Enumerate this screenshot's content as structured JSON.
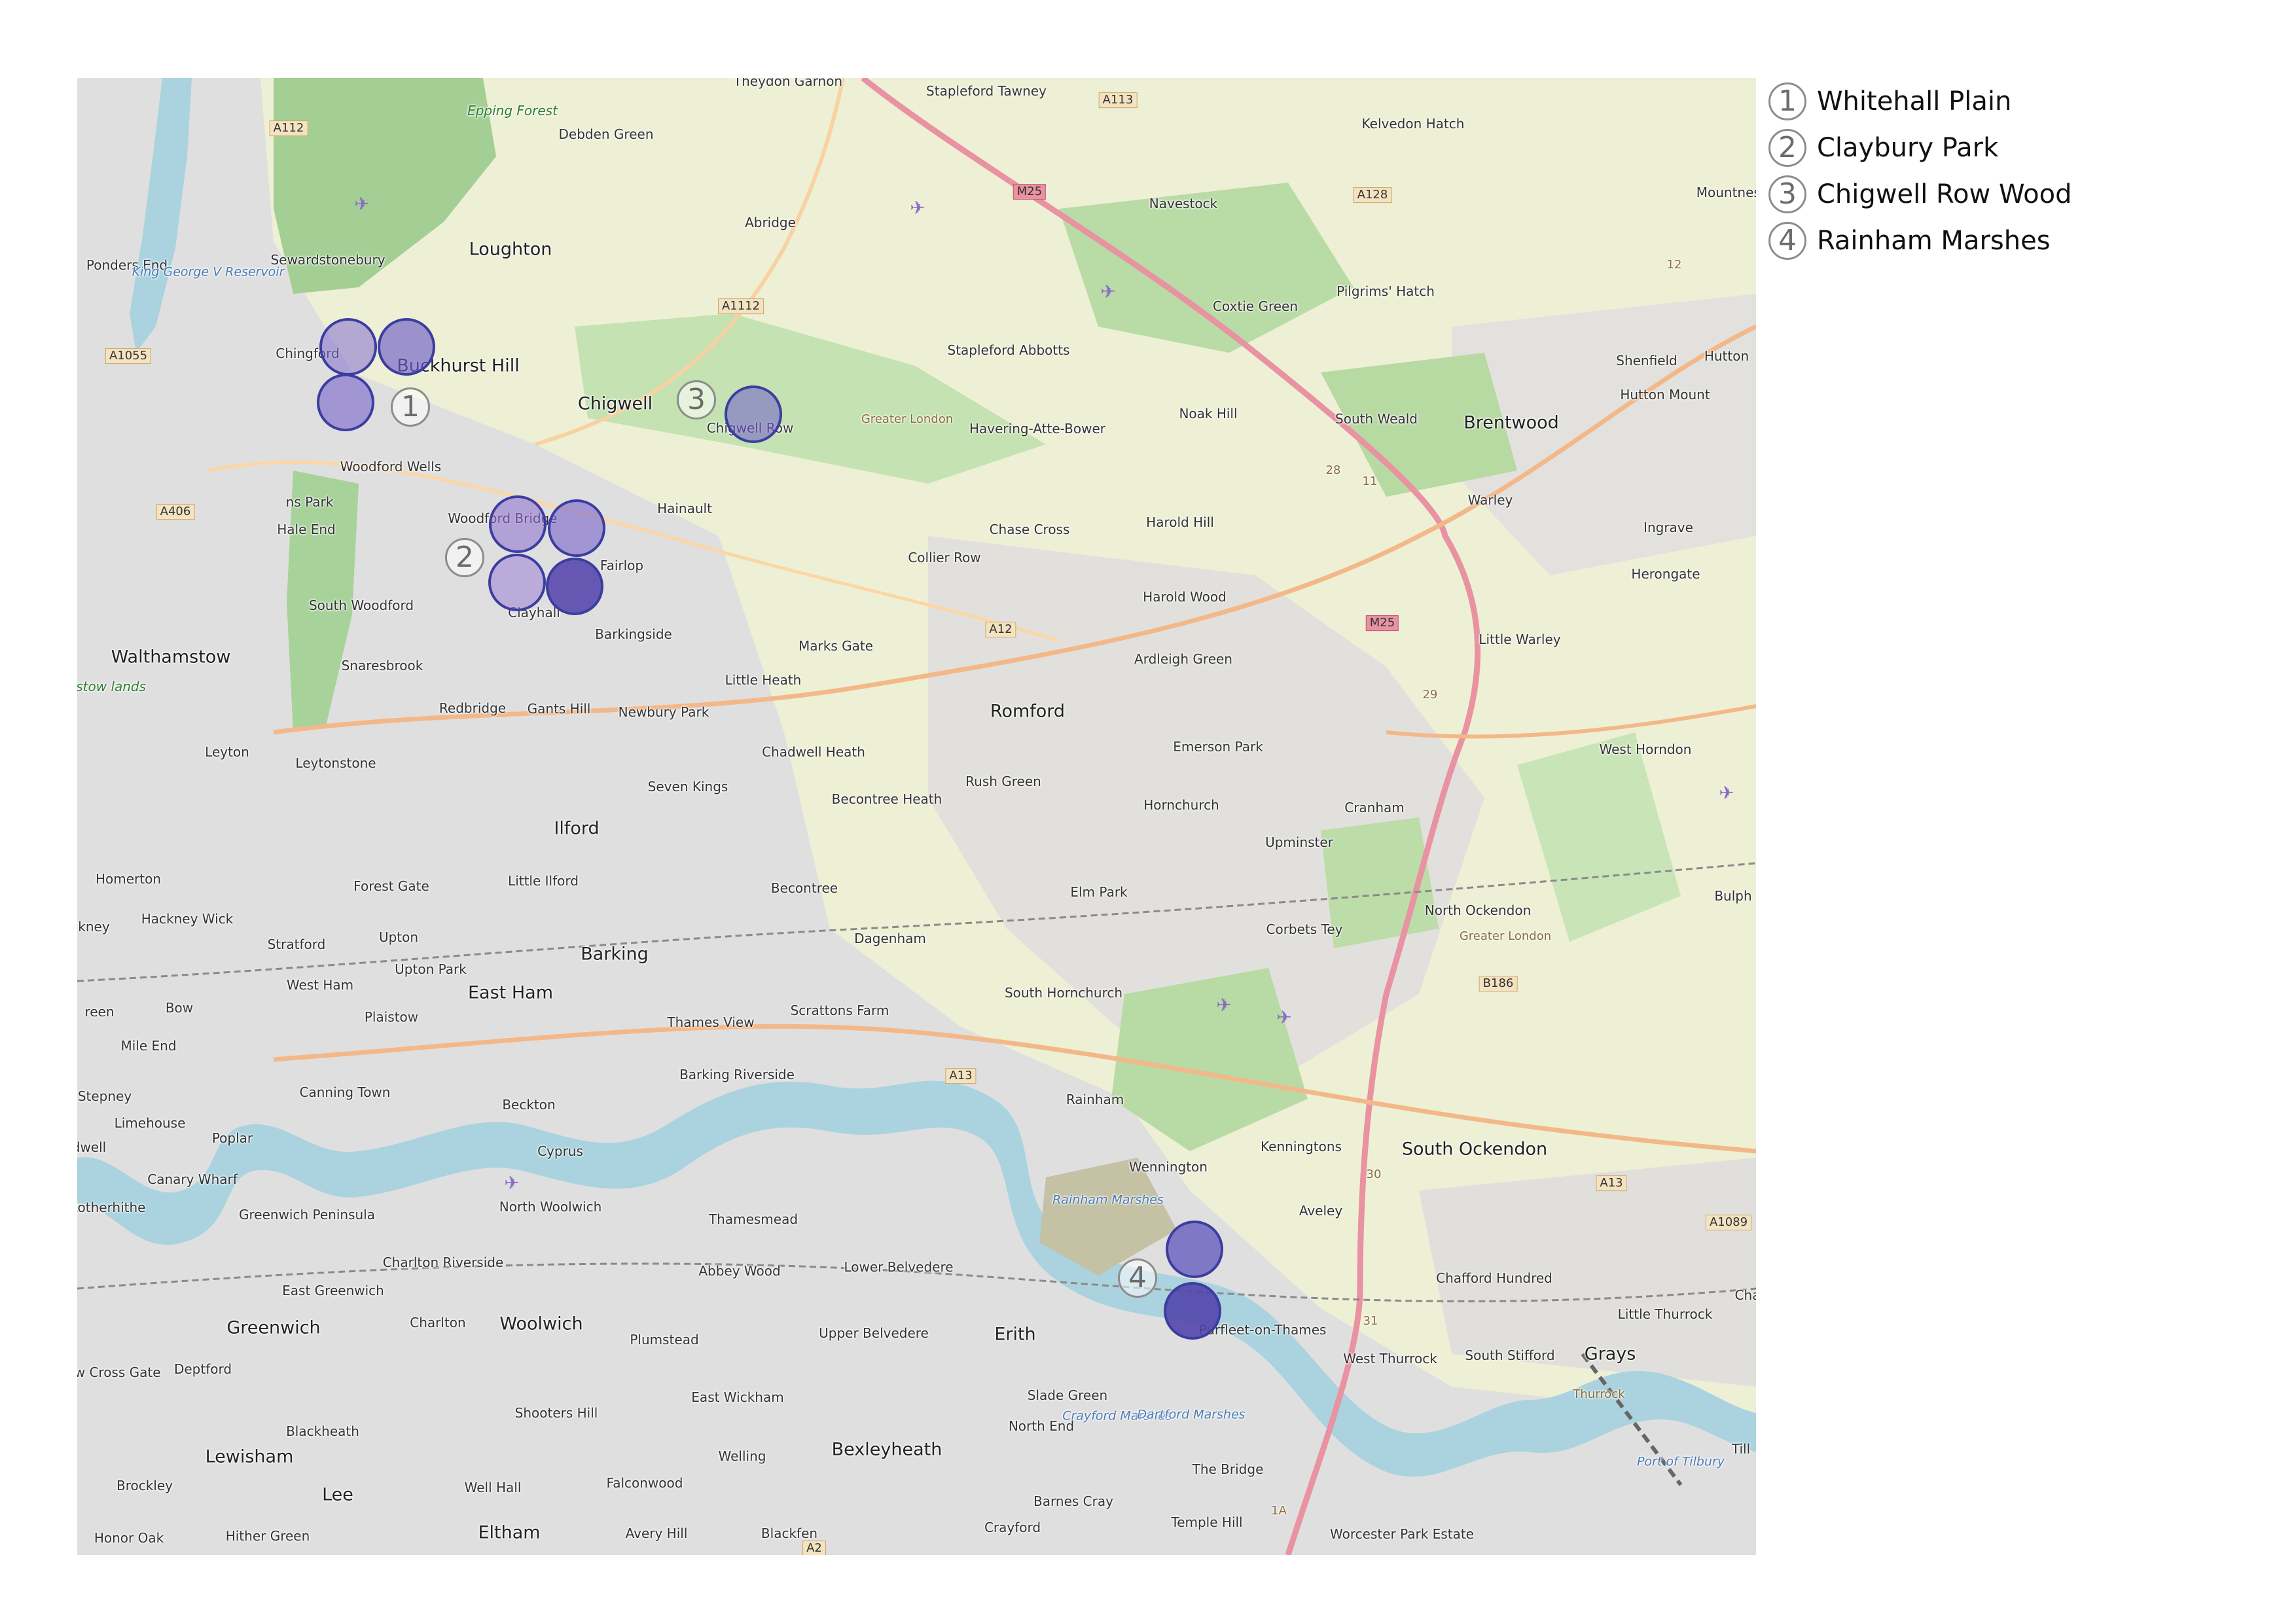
{
  "legend": [
    {
      "num": "1",
      "label": "Whitehall Plain"
    },
    {
      "num": "2",
      "label": "Claybury Park"
    },
    {
      "num": "3",
      "label": "Chigwell Row Wood"
    },
    {
      "num": "4",
      "label": "Rainham Marshes"
    }
  ],
  "markers": [
    "1",
    "2",
    "3",
    "4"
  ],
  "colors": {
    "site_fill": "#6a5acd",
    "site_stroke": "#3b3ea0",
    "water": "#aad3df",
    "forest": "#a4cf94",
    "farmland": "#eef0d5",
    "urban": "#e0dfdf",
    "motorway": "#e892a2"
  },
  "places": {
    "theydon_garnon": "Theydon Garnon",
    "stapleford_tawney": "Stapleford Tawney",
    "kelvedon_hatch": "Kelvedon Hatch",
    "epping_forest": "Epping Forest",
    "debden_green": "Debden Green",
    "mountness": "Mountness",
    "navestock": "Navestock",
    "abridge": "Abridge",
    "ponders_end": "Ponders End",
    "king_george_reservoir": "King George V Reservoir",
    "sewardstonebury": "Sewardstonebury",
    "loughton": "Loughton",
    "pilgrims_hatch": "Pilgrims' Hatch",
    "coxtie_green": "Coxtie Green",
    "shenfield": "Shenfield",
    "hutton": "Hutton",
    "chingford": "Chingford",
    "buckhurst_hill": "Buckhurst Hill",
    "stapleford_abbotts": "Stapleford Abbotts",
    "chigwell": "Chigwell",
    "chigwell_row": "Chigwell Row",
    "greater_london_1": "Greater London",
    "havering_atte_bower": "Havering-Atte-Bower",
    "noak_hill": "Noak Hill",
    "south_weald": "South Weald",
    "brentwood": "Brentwood",
    "hutton_mount": "Hutton Mount",
    "woodford_wells": "Woodford Wells",
    "hainault": "Hainault",
    "warley": "Warley",
    "ingrave": "Ingrave",
    "chase_cross": "Chase Cross",
    "harold_hill": "Harold Hill",
    "woodford_bridge": "Woodford Bridge",
    "hale_end": "Hale End",
    "fairlop": "Fairlop",
    "collier_row": "Collier Row",
    "herongate": "Herongate",
    "south_woodford": "South Woodford",
    "clayhall": "Clayhall",
    "harold_wood": "Harold Wood",
    "barkingside": "Barkingside",
    "marks_gate": "Marks Gate",
    "little_warley": "Little Warley",
    "walthamstow": "Walthamstow",
    "snaresbrook": "Snaresbrook",
    "ardleigh_green": "Ardleigh Green",
    "little_heath": "Little Heath",
    "redbridge": "Redbridge",
    "gants_hill": "Gants Hill",
    "newbury_park": "Newbury Park",
    "romford": "Romford",
    "leyton": "Leyton",
    "leytonstone": "Leytonstone",
    "chadwell_heath": "Chadwell Heath",
    "emerson_park": "Emerson Park",
    "west_horndon": "West Horndon",
    "seven_kings": "Seven Kings",
    "rush_green": "Rush Green",
    "becontree_heath": "Becontree Heath",
    "hornchurch": "Hornchurch",
    "cranham": "Cranham",
    "ilford": "Ilford",
    "upminster": "Upminster",
    "homerton": "Homerton",
    "forest_gate": "Forest Gate",
    "little_ilford": "Little Ilford",
    "becontree": "Becontree",
    "elm_park": "Elm Park",
    "hackney_wick": "Hackney Wick",
    "north_ockendon": "North Ockendon",
    "stratford": "Stratford",
    "upton": "Upton",
    "dagenham": "Dagenham",
    "corbets_tey": "Corbets Tey",
    "greater_london_2": "Greater London",
    "barking": "Barking",
    "upton_park": "Upton Park",
    "west_ham": "West Ham",
    "east_ham": "East Ham",
    "south_hornchurch": "South Hornchurch",
    "bow": "Bow",
    "plaistow": "Plaistow",
    "thames_view": "Thames View",
    "scrattons_farm": "Scrattons Farm",
    "mile_end": "Mile End",
    "barking_riverside": "Barking Riverside",
    "canning_town": "Canning Town",
    "rainham": "Rainham",
    "stepney": "Stepney",
    "beckton": "Beckton",
    "limehouse": "Limehouse",
    "poplar": "Poplar",
    "cyprus": "Cyprus",
    "kenningtons": "Kenningtons",
    "wennington": "Wennington",
    "south_ockendon": "South Ockendon",
    "canary_wharf": "Canary Wharf",
    "rotherhithe": "Rotherhithe",
    "north_woolwich": "North Woolwich",
    "rainham_marshes": "Rainham Marshes",
    "greenwich_peninsula": "Greenwich Peninsula",
    "thamesmead": "Thamesmead",
    "aveley": "Aveley",
    "charlton_riverside": "Charlton Riverside",
    "abbey_wood": "Abbey Wood",
    "lower_belvedere": "Lower Belvedere",
    "chafford_hundred": "Chafford Hundred",
    "east_greenwich": "East Greenwich",
    "purfleet": "Purfleet-on-Thames",
    "little_thurrock": "Little Thurrock",
    "greenwich": "Greenwich",
    "charlton": "Charlton",
    "woolwich": "Woolwich",
    "plumstead": "Plumstead",
    "upper_belvedere": "Upper Belvedere",
    "erith": "Erith",
    "west_thurrock": "West Thurrock",
    "south_stifford": "South Stifford",
    "grays": "Grays",
    "new_cross_gate": "New Cross Gate",
    "deptford": "Deptford",
    "east_wickham": "East Wickham",
    "slade_green": "Slade Green",
    "thurrock": "Thurrock",
    "crayford_marshes": "Crayford Marshes",
    "dartford_marshes": "Dartford Marshes",
    "shooters_hill": "Shooters Hill",
    "north_end": "North End",
    "blackheath": "Blackheath",
    "bexleyheath": "Bexleyheath",
    "lewisham": "Lewisham",
    "welling": "Welling",
    "port_of_tilbury": "Port of Tilbury",
    "the_bridge": "The Bridge",
    "brockley": "Brockley",
    "well_hall": "Well Hall",
    "falconwood": "Falconwood",
    "lee": "Lee",
    "barnes_cray": "Barnes Cray",
    "temple_hill": "Temple Hill",
    "honor_oak": "Honor Oak",
    "hither_green": "Hither Green",
    "eltham": "Eltham",
    "avery_hill": "Avery Hill",
    "blackfen": "Blackfen",
    "crayford": "Crayford",
    "worcester_park_estate": "Worcester Park Estate",
    "chingford_hatch": "ns Park",
    "lamstow": "lamstow lands",
    "ckney": "ckney",
    "reen": "reen",
    "dwell": "dwell",
    "bulph": "Bulph",
    "till": "Till",
    "cha": "Cha"
  },
  "roads": {
    "a112": "A112",
    "a113": "A113",
    "a128": "A128",
    "m25": "M25",
    "a1055": "A1055",
    "a1112": "A1112",
    "a406": "A406",
    "a12": "A12",
    "m25_b": "M25",
    "b186": "B186",
    "a13": "A13",
    "a13_b": "A13",
    "a1089": "A1089",
    "a2": "A2",
    "j28": "28",
    "j11": "11",
    "j29": "29",
    "j30": "30",
    "j31": "31",
    "j1a": "1A",
    "j12": "12"
  }
}
